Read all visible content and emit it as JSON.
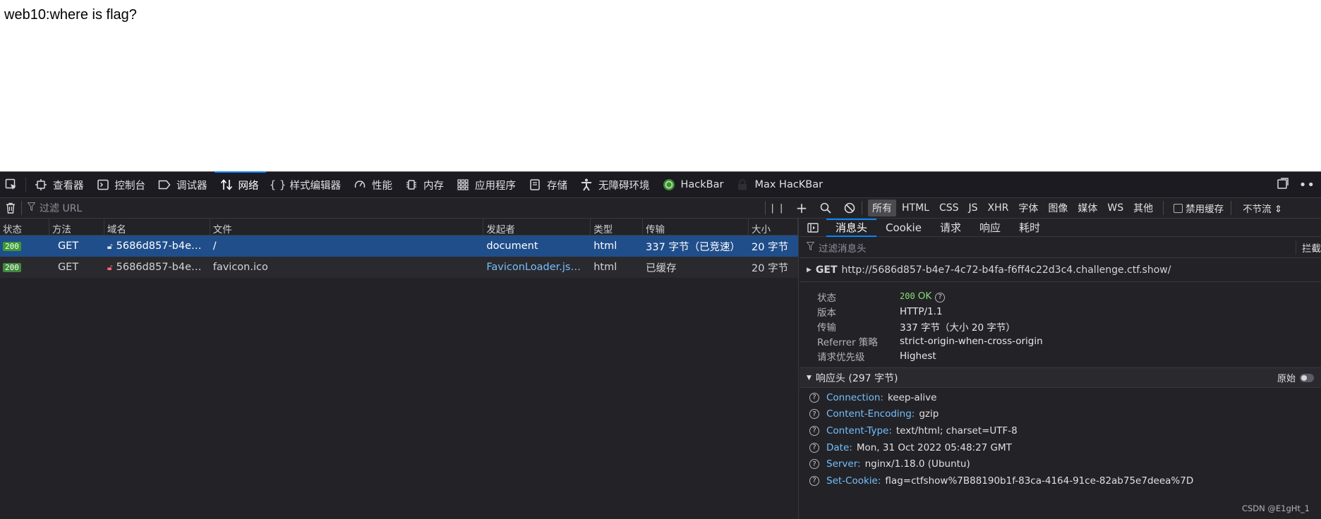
{
  "page": {
    "text": "web10:where is flag?"
  },
  "toolbar": {
    "tabs": [
      {
        "label": "查看器",
        "icon": "inspector-icon"
      },
      {
        "label": "控制台",
        "icon": "console-icon"
      },
      {
        "label": "调试器",
        "icon": "debugger-icon"
      },
      {
        "label": "网络",
        "icon": "network-icon",
        "active": true
      },
      {
        "label": "样式编辑器",
        "icon": "style-editor-icon"
      },
      {
        "label": "性能",
        "icon": "performance-icon"
      },
      {
        "label": "内存",
        "icon": "memory-icon"
      },
      {
        "label": "应用程序",
        "icon": "application-icon"
      },
      {
        "label": "存储",
        "icon": "storage-icon"
      },
      {
        "label": "无障碍环境",
        "icon": "accessibility-icon"
      },
      {
        "label": "HackBar",
        "icon": "hackbar-icon"
      },
      {
        "label": "Max HacKBar",
        "icon": "max-hackbar-icon"
      }
    ]
  },
  "filterbar": {
    "url_placeholder": "过滤 URL",
    "types": [
      "所有",
      "HTML",
      "CSS",
      "JS",
      "XHR",
      "字体",
      "图像",
      "媒体",
      "WS",
      "其他"
    ],
    "disable_cache": "禁用缓存",
    "throttle": "不节流 ⇕"
  },
  "columns": [
    "状态",
    "方法",
    "域名",
    "文件",
    "发起者",
    "类型",
    "传输",
    "大小"
  ],
  "requests": [
    {
      "status": "200",
      "method": "GET",
      "domain": "5686d857-b4e7...",
      "file": "/",
      "initiator": "document",
      "type": "html",
      "transfer": "337 字节（已竞速）",
      "size": "20 字节"
    },
    {
      "status": "200",
      "method": "GET",
      "domain": "5686d857-b4e7...",
      "file": "favicon.ico",
      "initiator": "FaviconLoader.jsm:...",
      "type": "html",
      "transfer": "已缓存",
      "size": "20 字节"
    }
  ],
  "sidepanel": {
    "tabs": [
      "消息头",
      "Cookie",
      "请求",
      "响应",
      "耗时"
    ],
    "filter_placeholder": "过滤消息头",
    "block_label": "拦截",
    "request_method": "GET",
    "request_url": "http://5686d857-b4e7-4c72-b4fa-f6ff4c22d3c4.challenge.ctf.show/",
    "summary": {
      "status_key": "状态",
      "status_code": "200",
      "status_text": "OK",
      "version_key": "版本",
      "version": "HTTP/1.1",
      "transfer_key": "传输",
      "transfer": "337 字节（大小 20 字节）",
      "referrer_key": "Referrer 策略",
      "referrer": "strict-origin-when-cross-origin",
      "priority_key": "请求优先级",
      "priority": "Highest"
    },
    "response_headers_title": "响应头 (297 字节)",
    "raw_label": "原始",
    "response_headers": [
      {
        "key": "Connection:",
        "value": "keep-alive"
      },
      {
        "key": "Content-Encoding:",
        "value": "gzip"
      },
      {
        "key": "Content-Type:",
        "value": "text/html; charset=UTF-8"
      },
      {
        "key": "Date:",
        "value": "Mon, 31 Oct 2022 05:48:27 GMT"
      },
      {
        "key": "Server:",
        "value": "nginx/1.18.0 (Ubuntu)"
      },
      {
        "key": "Set-Cookie:",
        "value": "flag=ctfshow%7B88190b1f-83ca-4164-91ce-82ab75e7deea%7D"
      }
    ]
  },
  "watermark": "CSDN @E1gHt_1",
  "colors": {
    "accent": "#0a84ff",
    "selected_row": "#204e8a",
    "status_ok": "#86de74",
    "header_key": "#75bfff"
  }
}
